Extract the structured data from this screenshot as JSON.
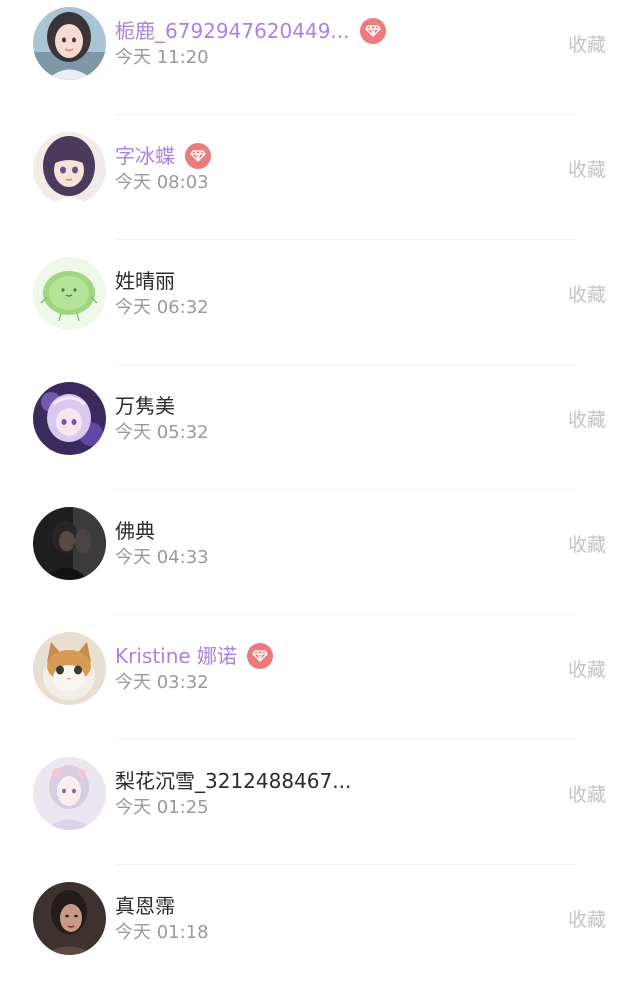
{
  "accent": {
    "vip_name": "#a883e6",
    "vip_badge": "#ec7b7b",
    "favorite_text": "#c4c4c4",
    "time_text": "#9a9a9a"
  },
  "users": [
    {
      "name": "栀鹿_6792947620449...",
      "time": "今天 11:20",
      "vip": true,
      "favorite_label": "收藏",
      "avatar": "anime-girl-avatar"
    },
    {
      "name": "字冰蝶",
      "time": "今天 08:03",
      "vip": true,
      "favorite_label": "收藏",
      "avatar": "anime-girl-purple-hair-avatar"
    },
    {
      "name": "姓晴丽",
      "time": "今天 06:32",
      "vip": false,
      "favorite_label": "收藏",
      "avatar": "green-blob-avatar"
    },
    {
      "name": "万隽美",
      "time": "今天 05:32",
      "vip": false,
      "favorite_label": "收藏",
      "avatar": "purple-anime-avatar"
    },
    {
      "name": "佛典",
      "time": "今天 04:33",
      "vip": false,
      "favorite_label": "收藏",
      "avatar": "dark-photo-avatar"
    },
    {
      "name": "Kristine 娜诺",
      "time": "今天 03:32",
      "vip": true,
      "favorite_label": "收藏",
      "avatar": "cat-avatar"
    },
    {
      "name": "梨花沉雪_3212488467...",
      "time": "今天 01:25",
      "vip": false,
      "favorite_label": "收藏",
      "avatar": "ancient-style-girl-avatar"
    },
    {
      "name": "真恩霈",
      "time": "今天 01:18",
      "vip": false,
      "favorite_label": "收藏",
      "avatar": "portrait-photo-avatar"
    }
  ]
}
